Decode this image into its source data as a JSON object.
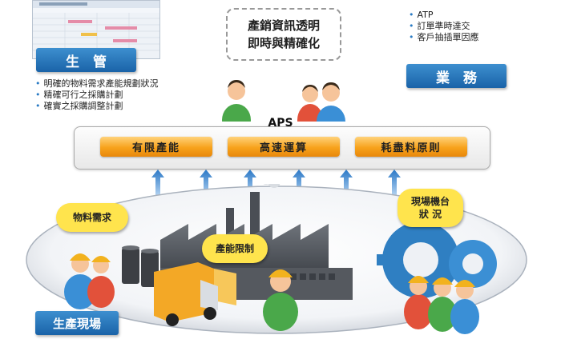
{
  "production": {
    "title": "生　管",
    "bullets": [
      "明確的物料需求產能規劃狀況",
      "精確可行之採購計劃",
      "確實之採購調整計劃"
    ]
  },
  "business": {
    "title": "業　務",
    "bullets": [
      "ATP",
      "訂單準時達交",
      "客戶抽插單因應"
    ]
  },
  "callout": {
    "line1": "產銷資訊透明",
    "line2": "即時與精確化"
  },
  "aps": {
    "title": "APS",
    "modules": [
      "有限產能",
      "高速運算",
      "耗盡料原則"
    ]
  },
  "shop_floor": {
    "title": "生產現場",
    "bubble_material": "物料需求",
    "bubble_capacity": "產能限制",
    "bubble_machine_line1": "現場機台",
    "bubble_machine_line2": "狀 況"
  },
  "colors": {
    "primary_blue": "#1f6fb8",
    "module_orange": "#f7a21b",
    "bubble_yellow": "#ffe44d",
    "arrow_blue": "#3a86d0"
  }
}
